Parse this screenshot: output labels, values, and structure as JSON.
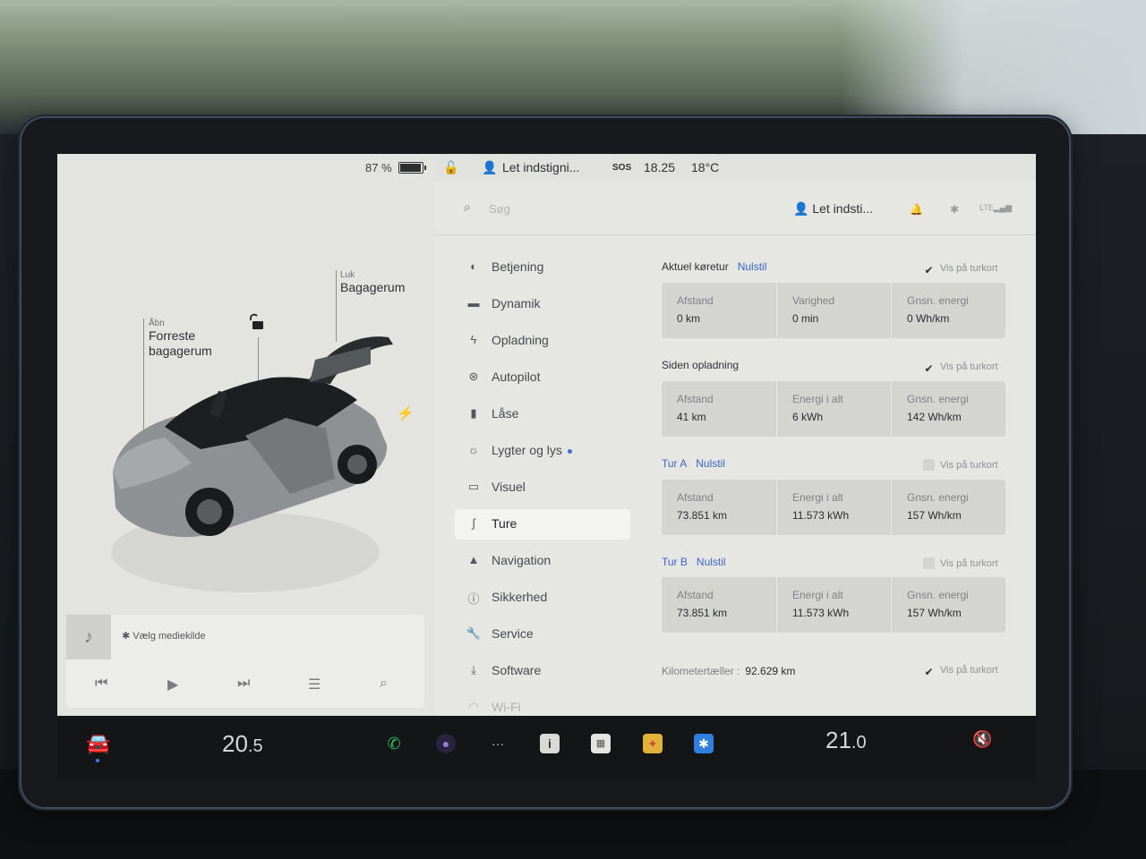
{
  "car_panel": {
    "battery_percent_label": "87 %",
    "battery_level": 0.87,
    "trunk": {
      "small": "Luk",
      "big": "Bagagerum"
    },
    "frunk": {
      "small": "Åbn",
      "big_line1": "Forreste",
      "big_line2": "bagagerum"
    }
  },
  "media": {
    "source_label": "Vælg mediekilde",
    "icons": [
      "music-note-icon",
      "bluetooth-icon",
      "previous-track-icon",
      "play-icon",
      "next-track-icon",
      "equalizer-icon",
      "search-icon"
    ]
  },
  "status_bar": {
    "profile_name": "Let indstigni...",
    "sos_label": "SOS",
    "time": "18.25",
    "outside_temp": "18°C"
  },
  "settings_header": {
    "search_placeholder": "Søg",
    "profile_name": "Let indsti...",
    "icons": [
      "bell-icon",
      "bluetooth-icon",
      "lte-signal-icon"
    ]
  },
  "nav": {
    "items": [
      {
        "label": "Betjening",
        "icon": "toggle-icon"
      },
      {
        "label": "Dynamik",
        "icon": "car-icon"
      },
      {
        "label": "Opladning",
        "icon": "bolt-icon"
      },
      {
        "label": "Autopilot",
        "icon": "steering-wheel-icon"
      },
      {
        "label": "Låse",
        "icon": "lock-icon"
      },
      {
        "label": "Lygter og lys",
        "icon": "sun-icon"
      },
      {
        "label": "Visuel",
        "icon": "display-icon"
      },
      {
        "label": "Ture",
        "icon": "trips-icon",
        "active": true
      },
      {
        "label": "Navigation",
        "icon": "navigation-icon"
      },
      {
        "label": "Sikkerhed",
        "icon": "safety-icon"
      },
      {
        "label": "Service",
        "icon": "wrench-icon"
      },
      {
        "label": "Software",
        "icon": "download-icon"
      },
      {
        "label": "Wi-Fi",
        "icon": "wifi-icon"
      }
    ]
  },
  "trips": {
    "show_on_card": "Vis på turkort",
    "current": {
      "title": "Aktuel køretur",
      "reset": "Nulstil",
      "checked": true,
      "cells": [
        {
          "label": "Afstand",
          "value": "0 km"
        },
        {
          "label": "Varighed",
          "value": "0 min"
        },
        {
          "label": "Gnsn. energi",
          "value": "0 Wh/km"
        }
      ]
    },
    "since_charge": {
      "title": "Siden opladning",
      "checked": true,
      "cells": [
        {
          "label": "Afstand",
          "value": "41 km"
        },
        {
          "label": "Energi i alt",
          "value": "6 kWh"
        },
        {
          "label": "Gnsn. energi",
          "value": "142 Wh/km"
        }
      ]
    },
    "trip_a": {
      "title": "Tur A",
      "reset": "Nulstil",
      "checked": false,
      "cells": [
        {
          "label": "Afstand",
          "value": "73.851 km"
        },
        {
          "label": "Energi i alt",
          "value": "11.573 kWh"
        },
        {
          "label": "Gnsn. energi",
          "value": "157 Wh/km"
        }
      ]
    },
    "trip_b": {
      "title": "Tur B",
      "reset": "Nulstil",
      "checked": false,
      "cells": [
        {
          "label": "Afstand",
          "value": "73.851 km"
        },
        {
          "label": "Energi i alt",
          "value": "11.573 kWh"
        },
        {
          "label": "Gnsn. energi",
          "value": "157 Wh/km"
        }
      ]
    },
    "odometer": {
      "label": "Kilometertæller :",
      "value": "92.629 km",
      "checked": true
    }
  },
  "taskbar": {
    "driver_temp_whole": "20",
    "driver_temp_decimal": ".5",
    "passenger_temp_whole": "21",
    "passenger_temp_decimal": ".0",
    "apps": [
      "car-icon",
      "phone-icon",
      "camera-icon",
      "more-icon",
      "info-icon",
      "calendar-icon",
      "toybox-icon",
      "bluetooth-icon",
      "mute-icon"
    ]
  }
}
